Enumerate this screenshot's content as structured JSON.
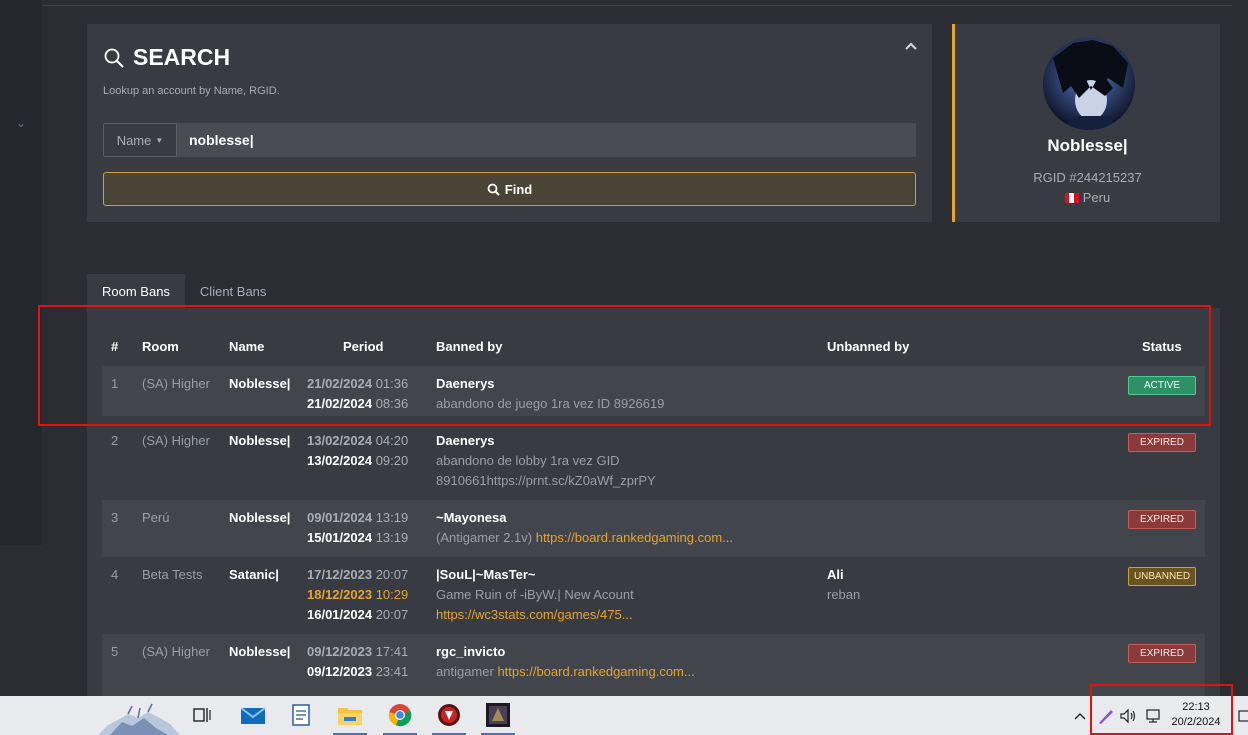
{
  "search": {
    "title": "SEARCH",
    "subtitle": "Lookup an account by Name, RGID.",
    "mode_label": "Name",
    "query": "noblesse|",
    "find_label": "Find"
  },
  "profile": {
    "name": "Noblesse|",
    "rgid": "RGID #244215237",
    "country": "Peru"
  },
  "tabs": [
    {
      "label": "Room Bans",
      "active": true
    },
    {
      "label": "Client Bans",
      "active": false
    }
  ],
  "table": {
    "headers": {
      "num": "#",
      "room": "Room",
      "name": "Name",
      "period": "Period",
      "banned_by": "Banned by",
      "unbanned_by": "Unbanned by",
      "status": "Status"
    },
    "rows": [
      {
        "num": "1",
        "room": "(SA) Higher",
        "name": "Noblesse|",
        "start_date": "21/02/2024",
        "start_time": "01:36",
        "end_date": "21/02/2024",
        "end_time": "08:36",
        "banned_by": "Daenerys",
        "reason": "abandono de juego 1ra vez ID 8926619",
        "reason2": "",
        "link": "",
        "unbanned_by": "",
        "unban_reason": "",
        "status": "ACTIVE"
      },
      {
        "num": "2",
        "room": "(SA) Higher",
        "name": "Noblesse|",
        "start_date": "13/02/2024",
        "start_time": "04:20",
        "end_date": "13/02/2024",
        "end_time": "09:20",
        "banned_by": "Daenerys",
        "reason": "abandono de lobby 1ra vez GID",
        "reason2": "8910661https://prnt.sc/kZ0aWf_zprPY",
        "link": "",
        "unbanned_by": "",
        "unban_reason": "",
        "status": "EXPIRED"
      },
      {
        "num": "3",
        "room": "Perú",
        "name": "Noblesse|",
        "start_date": "09/01/2024",
        "start_time": "13:19",
        "end_date": "15/01/2024",
        "end_time": "13:19",
        "banned_by": "~Mayonesa",
        "reason": "(Antigamer 2.1v)",
        "reason2": "",
        "link": "https://board.rankedgaming.com...",
        "unbanned_by": "",
        "unban_reason": "",
        "status": "EXPIRED"
      },
      {
        "num": "4",
        "room": "Beta Tests",
        "name": "Satanic|",
        "start_date": "17/12/2023",
        "start_time": "20:07",
        "mid_date": "18/12/2023",
        "mid_time": "10:29",
        "end_date": "16/01/2024",
        "end_time": "20:07",
        "banned_by": "|SouL|~MasTer~",
        "reason": "Game Ruin of -iByW.| New Acount",
        "reason2": "",
        "link": "https://wc3stats.com/games/475...",
        "unbanned_by": "Ali",
        "unban_reason": "reban",
        "status": "UNBANNED"
      },
      {
        "num": "5",
        "room": "(SA) Higher",
        "name": "Noblesse|",
        "start_date": "09/12/2023",
        "start_time": "17:41",
        "end_date": "09/12/2023",
        "end_time": "23:41",
        "banned_by": "rgc_invicto",
        "reason": "antigamer",
        "reason2": "",
        "link": "https://board.rankedgaming.com...",
        "unbanned_by": "",
        "unban_reason": "",
        "status": "EXPIRED"
      }
    ]
  },
  "taskbar": {
    "time": "22:13",
    "date": "20/2/2024"
  },
  "colors": {
    "accent": "#e6a32e",
    "active": "#2f8f67",
    "expired": "#8a3a3a",
    "unbanned": "#6a5320",
    "highlight": "#e01313"
  }
}
